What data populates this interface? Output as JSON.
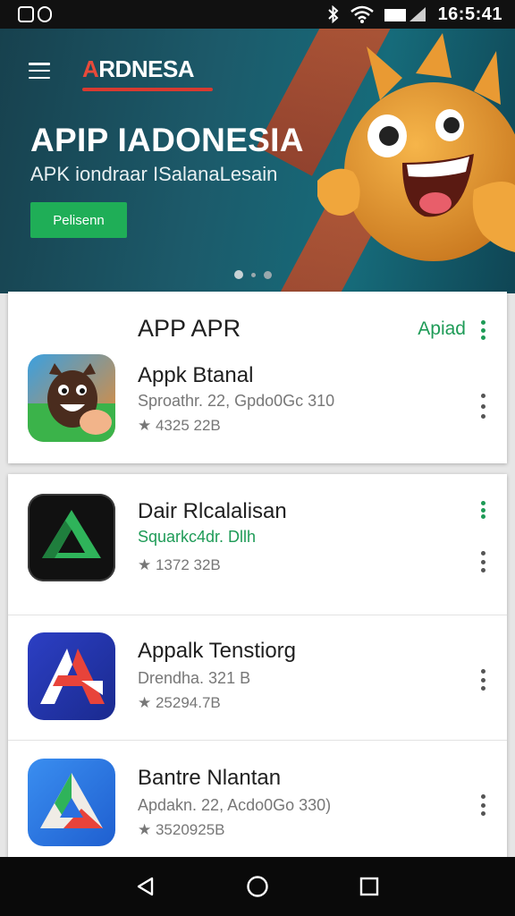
{
  "status_bar": {
    "time": "16:5:41"
  },
  "hero": {
    "logo_first": "A",
    "logo_rest": "RDNESA",
    "title": "APIP IADONESIA",
    "subtitle": "APK iondraar ISalanaLesain",
    "button": "Pelisenn",
    "slides": 3,
    "active_slide": 0
  },
  "featured": {
    "title": "APP APR",
    "action": "Apiad",
    "app": {
      "name": "Appk Btanal",
      "subtitle": "Sproathr. 22, Gpdo0Gc 310",
      "rating": "★ 4325 22B",
      "icon": "mascot-app-icon"
    }
  },
  "list": [
    {
      "name": "Dair Rlcalalisan",
      "subtitle": "Squarkc4dr. Dllh",
      "subtitle_color": "#1e9b57",
      "rating": "★ 1372 32B",
      "icon": "green-triangle-app-icon"
    },
    {
      "name": "Appalk Tenstiorg",
      "subtitle": "Drendha. 321 B",
      "rating": "★ 25294.7B",
      "icon": "red-a-app-icon"
    },
    {
      "name": "Bantre Nlantan",
      "subtitle": "Apdakn. 22, Acdo0Go 330)",
      "rating": "★ 3520925B",
      "icon": "blue-triangle-app-icon"
    }
  ],
  "colors": {
    "accent_green": "#1e9b57",
    "hero_dark": "#17414e",
    "brand_red": "#d83a30"
  }
}
